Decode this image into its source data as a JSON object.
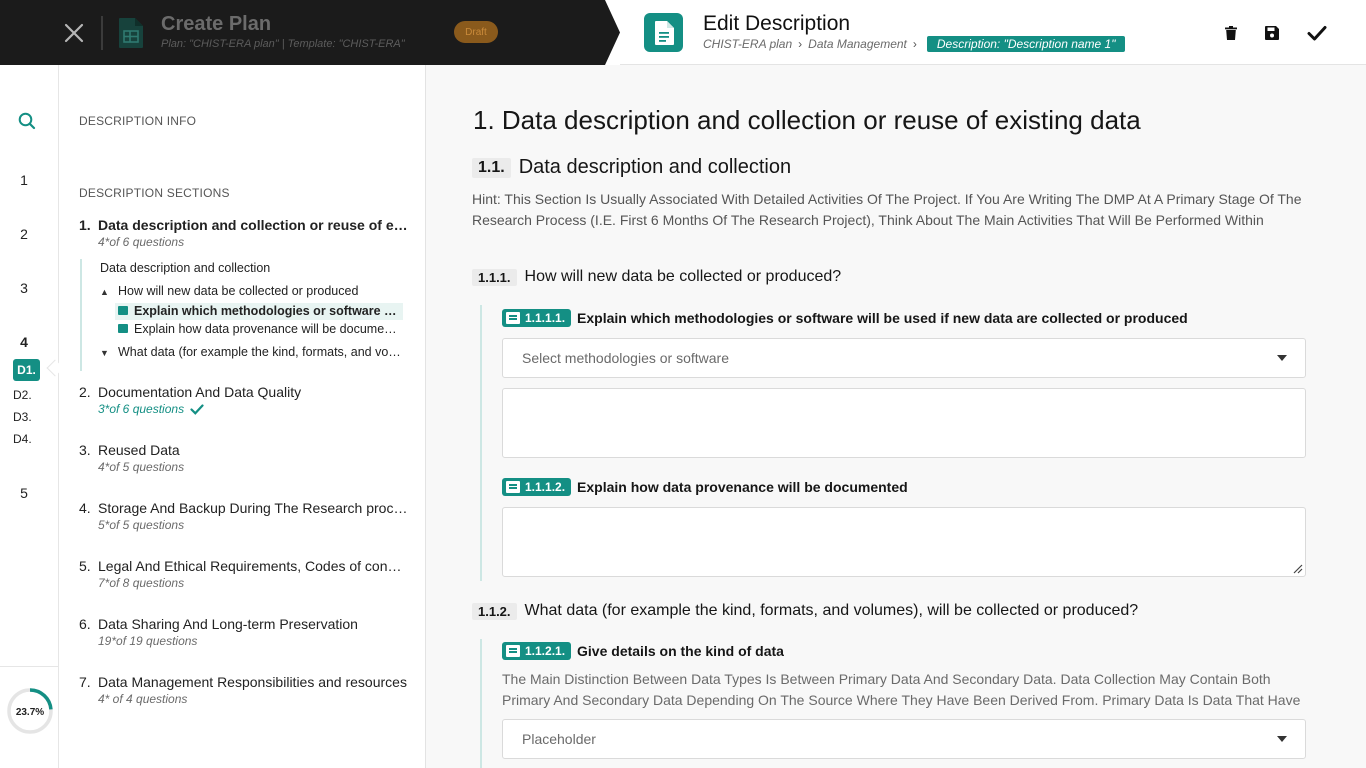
{
  "topbar": {
    "plan_title": "Create Plan",
    "plan_subtitle": "Plan: \"CHIST-ERA plan\"  |  Template: \"CHIST-ERA\"",
    "draft_badge": "Draft",
    "edit_title": "Edit Description",
    "breadcrumbs": [
      "CHIST-ERA plan",
      "Data Management"
    ],
    "breadcrumb_active": "Description: \"Description name 1\"",
    "icons": [
      "close-icon",
      "spreadsheet-icon",
      "document-icon",
      "trash-icon",
      "save-icon",
      "check-icon"
    ]
  },
  "rail": {
    "items": [
      "1",
      "2",
      "3",
      "4",
      "D1.",
      "D2.",
      "D3.",
      "D4.",
      "5"
    ],
    "active": "D1.",
    "progress": "23.7%",
    "progress_fraction": 0.237
  },
  "sidebar": {
    "info_heading": "DESCRIPTION INFO",
    "sections_heading": "DESCRIPTION SECTIONS",
    "sections": [
      {
        "num": "1.",
        "title": "Data description and collection or reuse of existing data",
        "count": "4*of 6 questions"
      },
      {
        "num": "2.",
        "title": "Documentation And Data Quality",
        "count": "3*of 6 questions",
        "complete": true
      },
      {
        "num": "3.",
        "title": "Reused Data",
        "count": "4*of 5 questions"
      },
      {
        "num": "4.",
        "title": "Storage And Backup During The Research process",
        "count": "5*of 5 questions"
      },
      {
        "num": "5.",
        "title": "Legal And Ethical Requirements, Codes of conduct",
        "count": "7*of 8 questions"
      },
      {
        "num": "6.",
        "title": "Data Sharing And Long-term Preservation",
        "count": "19*of 19 questions"
      },
      {
        "num": "7.",
        "title": "Data Management Responsibilities and resources",
        "count": "4* of 4 questions"
      }
    ],
    "tree": {
      "subsection": "Data description and collection",
      "q1": "How will new data be collected or produced",
      "q1_children": [
        "Explain which methodologies or software will be used if new data are collected or produced",
        "Explain how data provenance will be documented"
      ],
      "q2": "What data (for example the kind, formats, and volumes), will be collected or produced?"
    }
  },
  "main": {
    "chapter_title": "1. Data description and collection or reuse of existing data",
    "sub_num": "1.1.",
    "sub_title": "Data description and collection",
    "hint": "Hint: This Section Is Usually Associated With Detailed Activities Of The Project. If You Are Writing The DMP At A Primary Stage Of The Research Process (I.E. First 6 Months Of The Research Project), Think About The Main Activities That Will Be Performed Within",
    "q1_num": "1.1.1.",
    "q1_title": "How will new data be collected or produced?",
    "f1_num": "1.1.1.1.",
    "f1_label": "Explain which methodologies or software will be used if new data are collected or produced",
    "f1_select_placeholder": "Select methodologies or software",
    "f2_num": "1.1.1.2.",
    "f2_label": "Explain how data provenance will be documented",
    "q2_num": "1.1.2.",
    "q2_title": "What data (for example the kind, formats, and volumes), will be collected or produced?",
    "f3_num": "1.1.2.1.",
    "f3_label": "Give details on the kind of data",
    "f3_description": "The Main Distinction Between Data Types Is Between Primary Data And Secondary Data. Data Collection May Contain Both Primary And Secondary Data Depending On The Source Where They Have Been Derived From. Primary Data Is Data That Have",
    "f3_select_placeholder": "Placeholder"
  },
  "colors": {
    "accent": "#148f84",
    "topbar_dark": "#1b1b1b",
    "draft": "#8a5a1c"
  }
}
